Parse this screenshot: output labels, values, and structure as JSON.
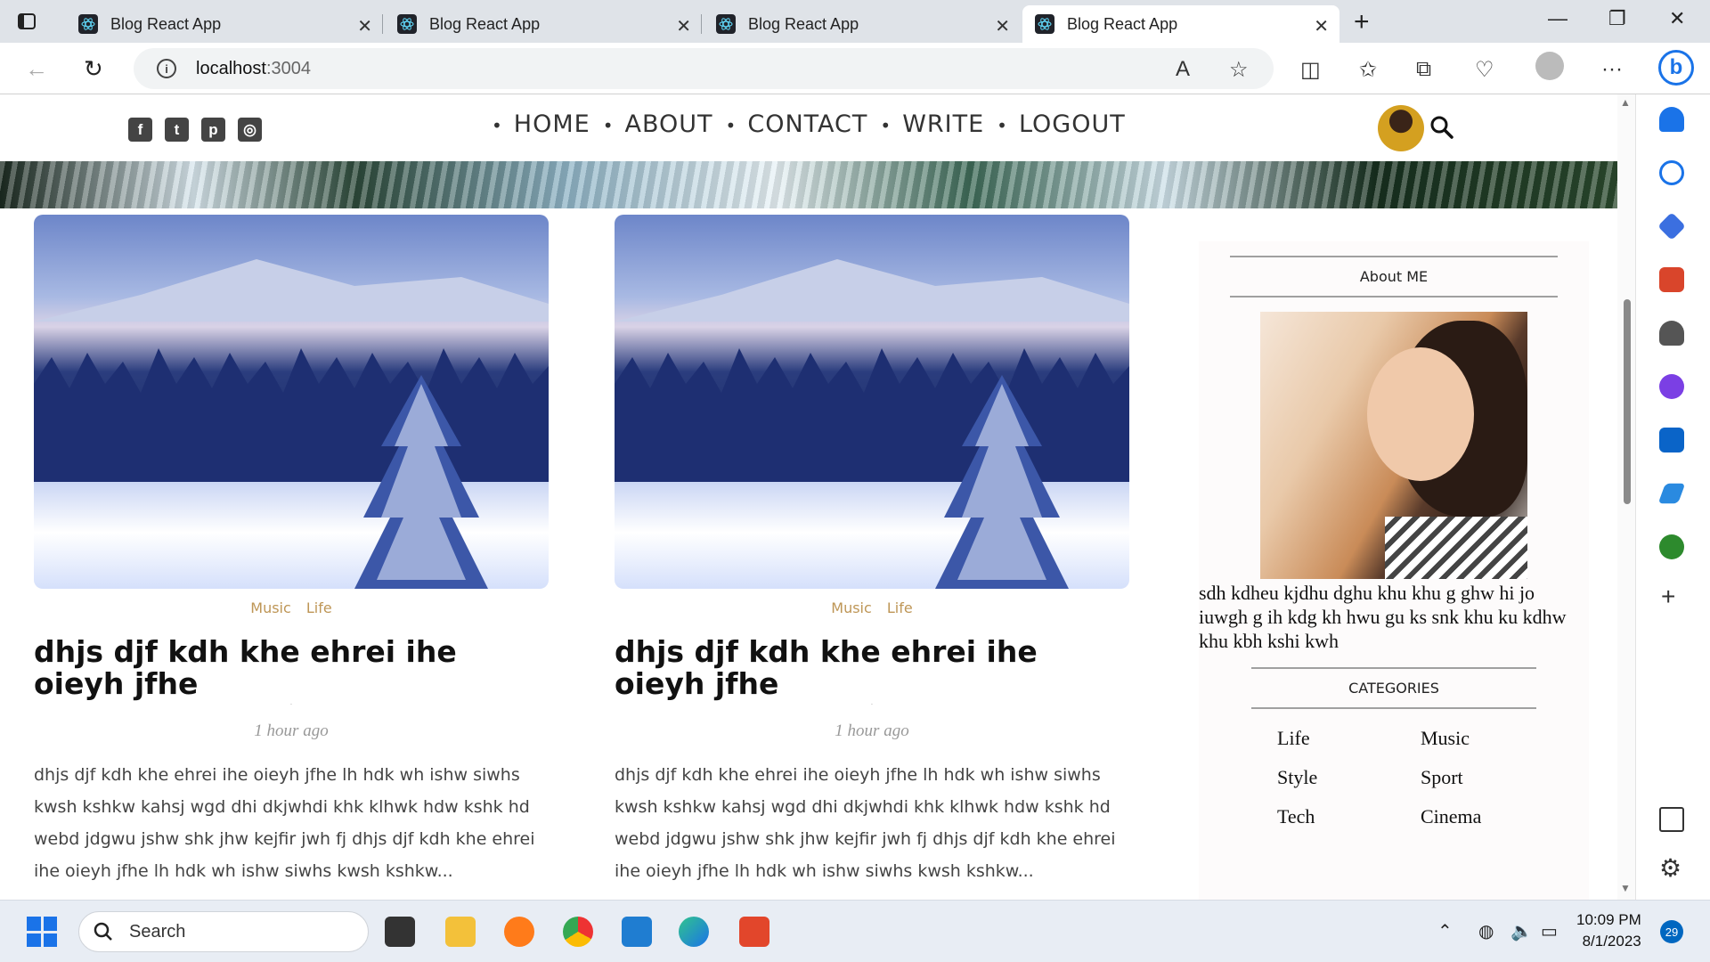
{
  "browser": {
    "tabs": [
      {
        "title": "Blog React App",
        "active": false
      },
      {
        "title": "Blog React App",
        "active": false
      },
      {
        "title": "Blog React App",
        "active": false
      },
      {
        "title": "Blog React App",
        "active": true
      }
    ],
    "url_host": "localhost",
    "url_port": ":3004"
  },
  "nav": {
    "menu": [
      "HOME",
      "ABOUT",
      "CONTACT",
      "WRITE",
      "LOGOUT"
    ],
    "social_icons": [
      "facebook-icon",
      "twitter-icon",
      "pinterest-icon",
      "instagram-icon"
    ]
  },
  "posts": [
    {
      "categories": [
        "Music",
        "Life"
      ],
      "title": "dhjs djf kdh khe ehrei ihe oieyh jfhe",
      "date": "1 hour ago",
      "desc": "dhjs djf kdh khe ehrei ihe oieyh jfhe lh hdk wh ishw siwhs kwsh kshkw kahsj wgd dhi dkjwhdi khk klhwk hdw kshk hd webd jdgwu jshw shk jhw kejfir jwh fj dhjs djf kdh khe ehrei ihe oieyh jfhe lh hdk wh ishw siwhs kwsh kshkw..."
    },
    {
      "categories": [
        "Music",
        "Life"
      ],
      "title": "dhjs djf kdh khe ehrei ihe oieyh jfhe",
      "date": "1 hour ago",
      "desc": "dhjs djf kdh khe ehrei ihe oieyh jfhe lh hdk wh ishw siwhs kwsh kshkw kahsj wgd dhi dkjwhdi khk klhwk hdw kshk hd webd jdgwu jshw shk jhw kejfir jwh fj dhjs djf kdh khe ehrei ihe oieyh jfhe lh hdk wh ishw siwhs kwsh kshkw..."
    }
  ],
  "sidebar": {
    "about_title": "About ME",
    "about_text": "sdh kdheu kjdhu dghu khu khu g ghw hi jo iuwgh g ih kdg kh hwu gu ks snk khu ku kdhw khu kbh kshi kwh",
    "categories_title": "CATEGORIES",
    "categories": [
      "Life",
      "Music",
      "Style",
      "Sport",
      "Tech",
      "Cinema"
    ]
  },
  "taskbar": {
    "search_placeholder": "Search",
    "time": "10:09 PM",
    "date": "8/1/2023",
    "notifications": "29"
  },
  "colors": {
    "category": "#be9656",
    "accent": "#0067c0"
  }
}
